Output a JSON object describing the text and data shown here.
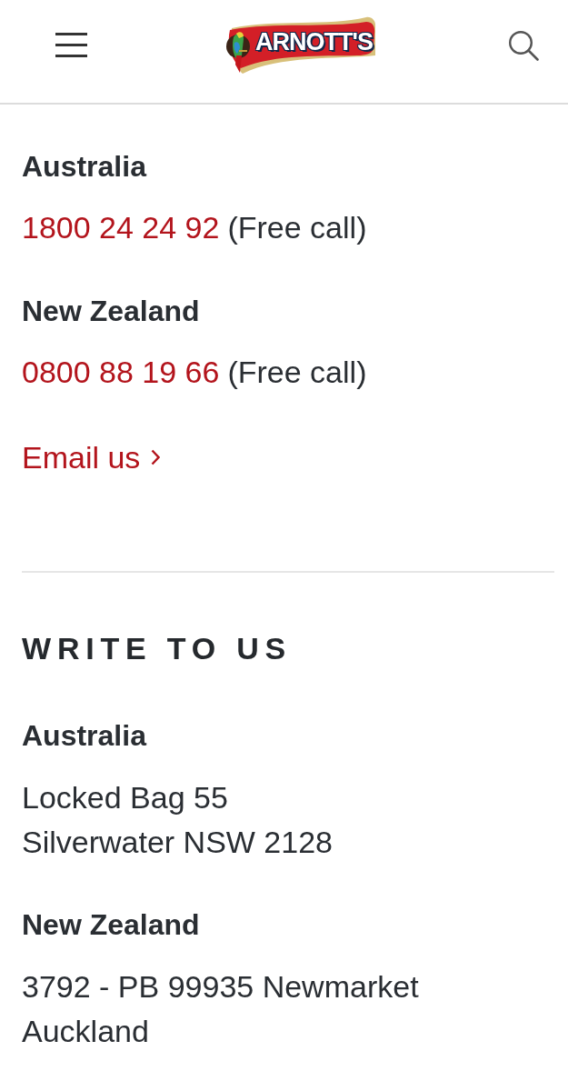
{
  "header": {
    "logo": {
      "text": "ARNOTT'S"
    }
  },
  "call_section": {
    "regions": [
      {
        "name": "Australia",
        "phone": "1800 24 24 92",
        "note": "(Free call)"
      },
      {
        "name": "New Zealand",
        "phone": "0800 88 19 66",
        "note": "(Free call)"
      }
    ],
    "email_link": {
      "label": "Email us"
    }
  },
  "write_section": {
    "title": "WRITE TO US",
    "regions": [
      {
        "name": "Australia",
        "address": [
          "Locked Bag 55",
          "Silverwater NSW 2128"
        ]
      },
      {
        "name": "New Zealand",
        "address": [
          "3792 - PB 99935 Newmarket",
          "Auckland"
        ]
      }
    ]
  }
}
